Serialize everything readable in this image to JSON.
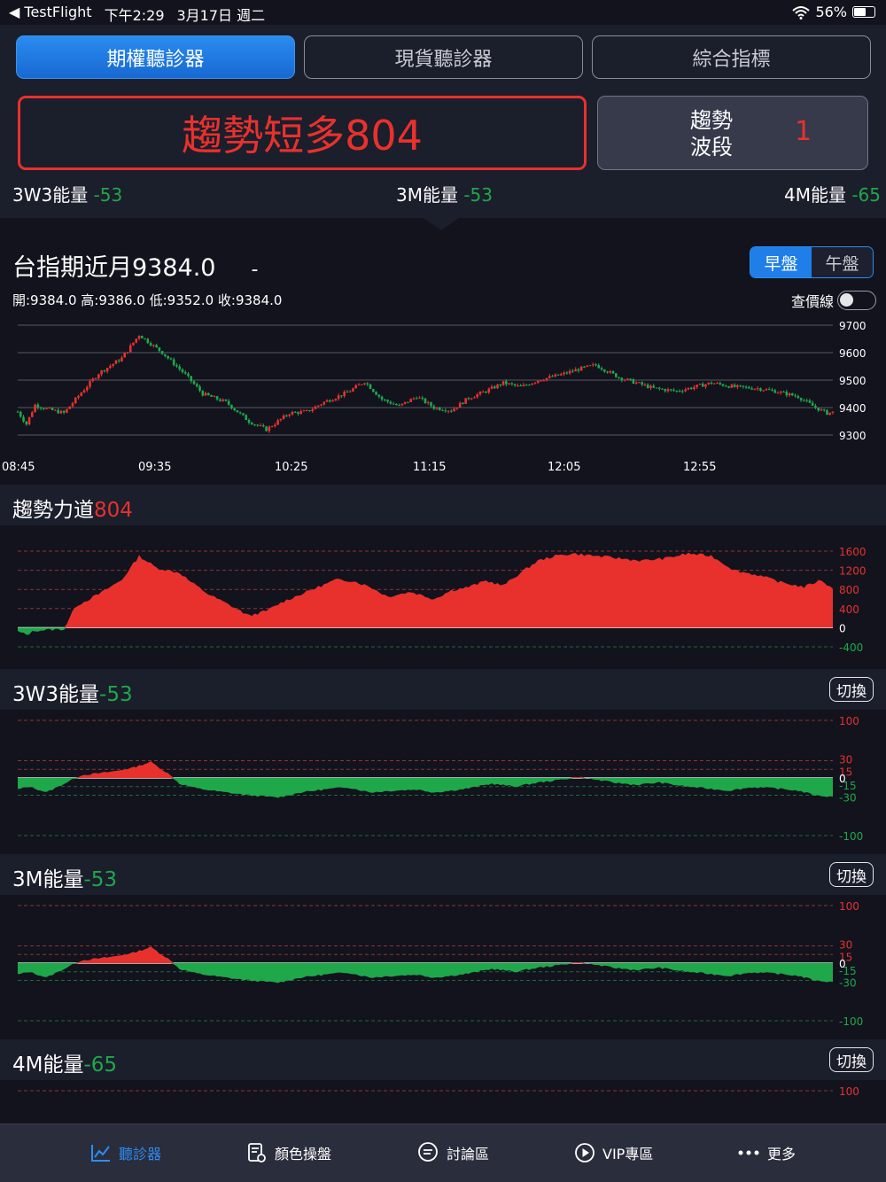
{
  "status": {
    "app": "TestFlight",
    "time": "下午2:29",
    "date": "3月17日 週二",
    "battery": "56%"
  },
  "tabs": [
    {
      "label": "期權聽診器",
      "active": true
    },
    {
      "label": "現貨聽診器",
      "active": false
    },
    {
      "label": "綜合指標",
      "active": false
    }
  ],
  "signal": {
    "text": "趨勢短多804"
  },
  "trend": {
    "label_line1": "趨勢",
    "label_line2": "波段",
    "value": "1"
  },
  "energy_summary": [
    {
      "label": "3W3能量",
      "value": "-53"
    },
    {
      "label": "3M能量",
      "value": "-53"
    },
    {
      "label": "4M能量",
      "value": "-65"
    }
  ],
  "price": {
    "title": "台指期近月9384.0",
    "change": "-",
    "ohlc": "開:9384.0 高:9386.0 低:9352.0 收:9384.0"
  },
  "session": {
    "morning": "早盤",
    "afternoon": "午盤"
  },
  "lookline_label": "查價線",
  "sections": {
    "trend_force": {
      "title": "趨勢力道",
      "value": "804"
    },
    "w3": {
      "title": "3W3能量",
      "value": "-53",
      "switch": "切換"
    },
    "m3": {
      "title": "3M能量",
      "value": "-53",
      "switch": "切換"
    },
    "m4": {
      "title": "4M能量",
      "value": "-65",
      "switch": "切換"
    }
  },
  "colors": {
    "up": "#e8312d",
    "down": "#1fa84a",
    "accent": "#1f7ee8",
    "panel": "#1b1e2b",
    "bg": "#12131d"
  },
  "nav": [
    {
      "label": "聽診器",
      "icon": "chart-line-icon",
      "active": true
    },
    {
      "label": "顏色操盤",
      "icon": "document-gear-icon",
      "active": false
    },
    {
      "label": "討論區",
      "icon": "chat-bubble-icon",
      "active": false
    },
    {
      "label": "VIP專區",
      "icon": "play-circle-icon",
      "active": false
    },
    {
      "label": "更多",
      "icon": "more-dots-icon",
      "active": false
    }
  ],
  "chart_data": [
    {
      "type": "candlestick",
      "title": "台指期近月",
      "x_ticks": [
        "08:45",
        "09:35",
        "10:25",
        "11:15",
        "12:05",
        "12:55"
      ],
      "y_ticks": [
        "9700",
        "9600",
        "9500",
        "9400",
        "9300"
      ],
      "ylim": [
        9300,
        9700
      ],
      "close_path": [
        [
          0,
          9385
        ],
        [
          3,
          9340
        ],
        [
          6,
          9410
        ],
        [
          10,
          9395
        ],
        [
          16,
          9380
        ],
        [
          22,
          9455
        ],
        [
          28,
          9525
        ],
        [
          36,
          9580
        ],
        [
          42,
          9665
        ],
        [
          50,
          9600
        ],
        [
          58,
          9520
        ],
        [
          64,
          9450
        ],
        [
          72,
          9420
        ],
        [
          80,
          9350
        ],
        [
          86,
          9320
        ],
        [
          94,
          9380
        ],
        [
          100,
          9385
        ],
        [
          106,
          9420
        ],
        [
          114,
          9455
        ],
        [
          120,
          9495
        ],
        [
          126,
          9430
        ],
        [
          132,
          9405
        ],
        [
          138,
          9440
        ],
        [
          144,
          9400
        ],
        [
          150,
          9390
        ],
        [
          156,
          9435
        ],
        [
          162,
          9460
        ],
        [
          168,
          9490
        ],
        [
          174,
          9475
        ],
        [
          180,
          9500
        ],
        [
          188,
          9520
        ],
        [
          194,
          9540
        ],
        [
          200,
          9555
        ],
        [
          208,
          9510
        ],
        [
          214,
          9490
        ],
        [
          220,
          9470
        ],
        [
          228,
          9460
        ],
        [
          234,
          9475
        ],
        [
          240,
          9490
        ],
        [
          248,
          9475
        ],
        [
          256,
          9470
        ],
        [
          262,
          9460
        ],
        [
          270,
          9440
        ],
        [
          276,
          9400
        ],
        [
          280,
          9380
        ],
        [
          282,
          9383
        ]
      ]
    },
    {
      "type": "area",
      "title": "趨勢力道",
      "y_ticks": [
        "1600",
        "1200",
        "800",
        "400",
        "0",
        "-400"
      ],
      "ylim": [
        -400,
        1600
      ],
      "values": [
        [
          0,
          -80
        ],
        [
          3,
          -150
        ],
        [
          6,
          -60
        ],
        [
          12,
          -40
        ],
        [
          16,
          -30
        ],
        [
          20,
          450
        ],
        [
          28,
          700
        ],
        [
          36,
          1000
        ],
        [
          42,
          1500
        ],
        [
          48,
          1250
        ],
        [
          56,
          1150
        ],
        [
          60,
          950
        ],
        [
          66,
          700
        ],
        [
          74,
          450
        ],
        [
          80,
          250
        ],
        [
          86,
          350
        ],
        [
          92,
          550
        ],
        [
          100,
          750
        ],
        [
          110,
          1000
        ],
        [
          116,
          980
        ],
        [
          122,
          850
        ],
        [
          128,
          650
        ],
        [
          136,
          750
        ],
        [
          144,
          600
        ],
        [
          150,
          780
        ],
        [
          156,
          850
        ],
        [
          162,
          980
        ],
        [
          168,
          880
        ],
        [
          174,
          1150
        ],
        [
          180,
          1400
        ],
        [
          186,
          1500
        ],
        [
          192,
          1550
        ],
        [
          200,
          1500
        ],
        [
          208,
          1450
        ],
        [
          216,
          1400
        ],
        [
          224,
          1450
        ],
        [
          232,
          1550
        ],
        [
          240,
          1500
        ],
        [
          248,
          1200
        ],
        [
          256,
          1100
        ],
        [
          264,
          950
        ],
        [
          272,
          850
        ],
        [
          278,
          1000
        ],
        [
          282,
          804
        ]
      ]
    },
    {
      "type": "area",
      "title": "3W3能量",
      "y_ticks": [
        "100",
        "30",
        "15",
        "0",
        "-15",
        "-30",
        "-100"
      ],
      "ylim": [
        -100,
        100
      ],
      "values": [
        [
          0,
          -20
        ],
        [
          4,
          -15
        ],
        [
          10,
          -25
        ],
        [
          16,
          -10
        ],
        [
          22,
          5
        ],
        [
          28,
          8
        ],
        [
          34,
          12
        ],
        [
          40,
          18
        ],
        [
          46,
          28
        ],
        [
          52,
          8
        ],
        [
          56,
          -10
        ],
        [
          62,
          -18
        ],
        [
          70,
          -24
        ],
        [
          80,
          -30
        ],
        [
          90,
          -34
        ],
        [
          98,
          -25
        ],
        [
          106,
          -20
        ],
        [
          114,
          -16
        ],
        [
          122,
          -25
        ],
        [
          130,
          -22
        ],
        [
          138,
          -20
        ],
        [
          144,
          -25
        ],
        [
          150,
          -22
        ],
        [
          156,
          -18
        ],
        [
          164,
          -10
        ],
        [
          172,
          -15
        ],
        [
          180,
          -8
        ],
        [
          188,
          -3
        ],
        [
          194,
          2
        ],
        [
          200,
          -3
        ],
        [
          206,
          -8
        ],
        [
          214,
          -12
        ],
        [
          222,
          -8
        ],
        [
          230,
          -14
        ],
        [
          238,
          -18
        ],
        [
          246,
          -22
        ],
        [
          254,
          -16
        ],
        [
          262,
          -18
        ],
        [
          270,
          -22
        ],
        [
          276,
          -30
        ],
        [
          282,
          -33
        ]
      ]
    },
    {
      "type": "area",
      "title": "3M能量",
      "y_ticks": [
        "100",
        "30",
        "15",
        "0",
        "-15",
        "-30",
        "-100"
      ],
      "ylim": [
        -100,
        100
      ],
      "values": [
        [
          0,
          -20
        ],
        [
          4,
          -15
        ],
        [
          10,
          -25
        ],
        [
          16,
          -10
        ],
        [
          22,
          5
        ],
        [
          28,
          8
        ],
        [
          34,
          12
        ],
        [
          40,
          18
        ],
        [
          46,
          28
        ],
        [
          52,
          8
        ],
        [
          56,
          -10
        ],
        [
          62,
          -18
        ],
        [
          70,
          -24
        ],
        [
          80,
          -30
        ],
        [
          90,
          -34
        ],
        [
          98,
          -25
        ],
        [
          106,
          -20
        ],
        [
          114,
          -16
        ],
        [
          122,
          -25
        ],
        [
          130,
          -22
        ],
        [
          138,
          -20
        ],
        [
          144,
          -25
        ],
        [
          150,
          -22
        ],
        [
          156,
          -18
        ],
        [
          164,
          -10
        ],
        [
          172,
          -15
        ],
        [
          180,
          -8
        ],
        [
          188,
          -3
        ],
        [
          194,
          2
        ],
        [
          200,
          -3
        ],
        [
          206,
          -8
        ],
        [
          214,
          -12
        ],
        [
          222,
          -8
        ],
        [
          230,
          -14
        ],
        [
          238,
          -18
        ],
        [
          246,
          -22
        ],
        [
          254,
          -16
        ],
        [
          262,
          -18
        ],
        [
          270,
          -22
        ],
        [
          276,
          -30
        ],
        [
          282,
          -33
        ]
      ]
    },
    {
      "type": "area",
      "title": "4M能量",
      "y_ticks": [
        "100"
      ],
      "ylim": [
        -100,
        100
      ],
      "values": []
    }
  ]
}
